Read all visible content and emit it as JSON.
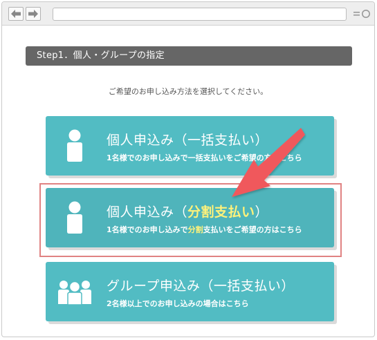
{
  "browser": {
    "url": "",
    "icons": {
      "back": "arrow-left-icon",
      "forward": "arrow-right-icon",
      "menu": "hamburger-icon"
    }
  },
  "step": {
    "title": "Step1．個人・グループの指定"
  },
  "instruction": "ご希望のお申し込み方法を選択してください。",
  "options": [
    {
      "title": "個人申込み（一括支払い）",
      "subtitle": "1名様でのお申し込みで一括支払いをご希望の方はこちら",
      "icon": "person-icon"
    },
    {
      "title_pre": "個人申込み（",
      "title_hl": "分割支払い",
      "title_post": "）",
      "subtitle_pre": "1名様でのお申し込みで",
      "subtitle_hl": "分割",
      "subtitle_post": "支払いをご希望の方はこちら",
      "icon": "person-icon",
      "highlighted": true
    },
    {
      "title": "グループ申込み（一括支払い）",
      "subtitle": "2名様以上でのお申し込みの場合はこちら",
      "icon": "group-icon"
    }
  ],
  "colors": {
    "card": "#52bcc3",
    "header": "#666666",
    "highlight_text": "#fff27a",
    "frame": "#e08282",
    "arrow": "#f0595c"
  }
}
